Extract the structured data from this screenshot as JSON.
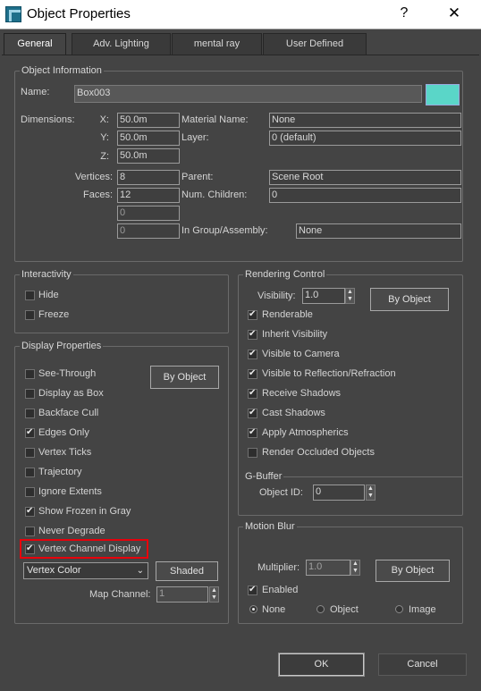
{
  "window": {
    "title": "Object Properties",
    "help": "?",
    "close": "✕"
  },
  "tabs": [
    {
      "label": "General"
    },
    {
      "label": "Adv. Lighting"
    },
    {
      "label": "mental ray"
    },
    {
      "label": "User Defined"
    }
  ],
  "object_info": {
    "title": "Object Information",
    "name_label": "Name:",
    "name_value": "Box003",
    "swatch_color": "#5ad6c8",
    "dimensions_label": "Dimensions:",
    "x_label": "X:",
    "x_value": "50.0m",
    "y_label": "Y:",
    "y_value": "50.0m",
    "z_label": "Z:",
    "z_value": "50.0m",
    "material_label": "Material Name:",
    "material_value": "None",
    "layer_label": "Layer:",
    "layer_value": "0 (default)",
    "vertices_label": "Vertices:",
    "vertices_value": "8",
    "faces_label": "Faces:",
    "faces_value": "12",
    "extra1_value": "0",
    "extra2_value": "0",
    "parent_label": "Parent:",
    "parent_value": "Scene Root",
    "children_label": "Num. Children:",
    "children_value": "0",
    "group_label": "In Group/Assembly:",
    "group_value": "None"
  },
  "interactivity": {
    "title": "Interactivity",
    "hide": "Hide",
    "freeze": "Freeze"
  },
  "display": {
    "title": "Display Properties",
    "by_object": "By Object",
    "items": [
      {
        "label": "See-Through",
        "checked": false
      },
      {
        "label": "Display as Box",
        "checked": false
      },
      {
        "label": "Backface Cull",
        "checked": false
      },
      {
        "label": "Edges Only",
        "checked": true
      },
      {
        "label": "Vertex Ticks",
        "checked": false
      },
      {
        "label": "Trajectory",
        "checked": false
      },
      {
        "label": "Ignore Extents",
        "checked": false
      },
      {
        "label": "Show Frozen in Gray",
        "checked": true
      },
      {
        "label": "Never Degrade",
        "checked": false
      },
      {
        "label": "Vertex Channel Display",
        "checked": true
      }
    ],
    "vertex_color": "Vertex Color",
    "shaded": "Shaded",
    "map_channel_label": "Map Channel:",
    "map_channel_value": "1"
  },
  "rendering": {
    "title": "Rendering Control",
    "visibility_label": "Visibility:",
    "visibility_value": "1.0",
    "by_object": "By Object",
    "items": [
      {
        "label": "Renderable",
        "checked": true
      },
      {
        "label": "Inherit Visibility",
        "checked": true
      },
      {
        "label": "Visible to Camera",
        "checked": true
      },
      {
        "label": "Visible to Reflection/Refraction",
        "checked": true
      },
      {
        "label": "Receive Shadows",
        "checked": true
      },
      {
        "label": "Cast Shadows",
        "checked": true
      },
      {
        "label": "Apply Atmospherics",
        "checked": true
      },
      {
        "label": "Render Occluded Objects",
        "checked": false
      }
    ]
  },
  "gbuffer": {
    "title": "G-Buffer",
    "object_id_label": "Object ID:",
    "object_id_value": "0"
  },
  "motion_blur": {
    "title": "Motion Blur",
    "multiplier_label": "Multiplier:",
    "multiplier_value": "1.0",
    "by_object": "By Object",
    "enabled": "Enabled",
    "radio_none": "None",
    "radio_object": "Object",
    "radio_image": "Image"
  },
  "footer": {
    "ok": "OK",
    "cancel": "Cancel"
  }
}
